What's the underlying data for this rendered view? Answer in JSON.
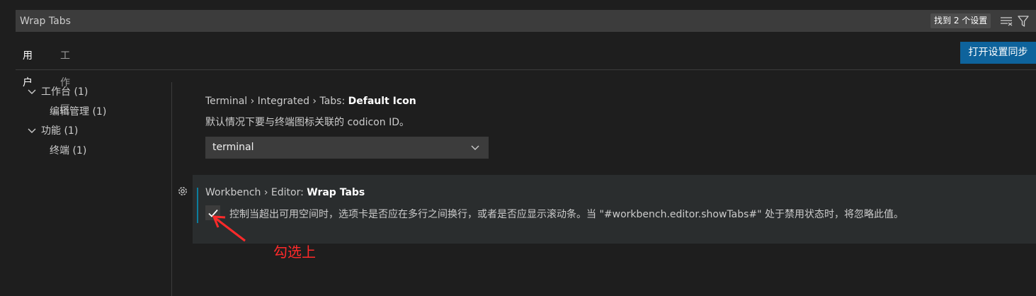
{
  "search": {
    "value": "Wrap Tabs",
    "result_count": "找到 2 个设置",
    "icons": [
      "clear-filter-icon",
      "filter-icon"
    ]
  },
  "tabs": [
    {
      "label": "用户",
      "active": true
    },
    {
      "label": "工作区",
      "active": false
    }
  ],
  "sync_button": "打开设置同步",
  "toc": [
    {
      "label": "工作台 (1)",
      "expanded": true,
      "level": 0
    },
    {
      "label": "编辑管理 (1)",
      "level": 1
    },
    {
      "label": "功能 (1)",
      "expanded": true,
      "level": 0
    },
    {
      "label": "终端 (1)",
      "level": 1
    }
  ],
  "settings": [
    {
      "category": "Terminal › Integrated › Tabs: ",
      "name": "Default Icon",
      "description": "默认情况下要与终端图标关联的 codicon ID。",
      "value": "terminal"
    },
    {
      "category": "Workbench › Editor: ",
      "name": "Wrap Tabs",
      "description": "控制当超出可用空间时，选项卡是否应在多行之间换行，或者是否应显示滚动条。当 \"#workbench.editor.showTabs#\" 处于禁用状态时，将忽略此值。",
      "checked": true
    }
  ],
  "annotation": {
    "text": "勾选上",
    "color": "#ff2a2a"
  },
  "colors": {
    "background": "#1e1e1e",
    "input_bg": "#3c3c3c",
    "accent_button": "#0e639c",
    "modified_indicator": "#0c7d9d"
  }
}
